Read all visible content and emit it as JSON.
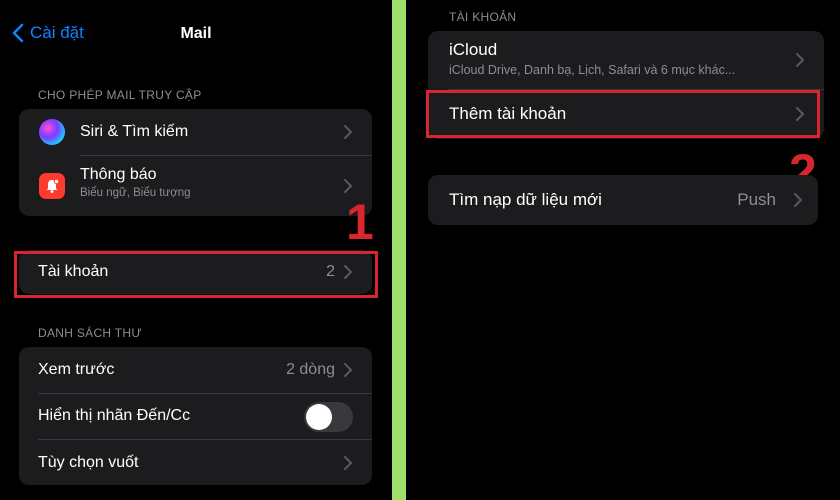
{
  "left": {
    "nav": {
      "back_label": "Cài đặt",
      "title": "Mail"
    },
    "access_section": {
      "header": "CHO PHÉP MAIL TRUY CẬP",
      "items": [
        {
          "label": "Siri & Tìm kiếm",
          "icon": "siri-icon"
        },
        {
          "label": "Thông báo",
          "sublabel": "Biểu ngữ, Biểu tượng",
          "icon": "notification-icon"
        }
      ]
    },
    "accounts_row": {
      "label": "Tài khoản",
      "value": "2"
    },
    "list_section": {
      "header": "DANH SÁCH THƯ",
      "items": [
        {
          "label": "Xem trước",
          "value": "2 dòng"
        },
        {
          "label": "Hiển thị nhãn Đến/Cc",
          "toggle_on": false
        },
        {
          "label": "Tùy chọn vuốt"
        }
      ]
    },
    "step_marker": "1"
  },
  "right": {
    "section_header": "TÀI KHOẢN",
    "icloud": {
      "label": "iCloud",
      "sublabel": "iCloud Drive, Danh bạ, Lịch, Safari và 6 mục khác..."
    },
    "add_account": {
      "label": "Thêm tài khoản"
    },
    "fetch": {
      "label": "Tìm nạp dữ liệu mới",
      "value": "Push"
    },
    "step_marker": "2"
  },
  "colors": {
    "background": "#000000",
    "cell": "#1c1c1e",
    "accent_blue": "#0a84ff",
    "highlight_red": "#d8262f",
    "divider_green": "#9ee06a"
  }
}
